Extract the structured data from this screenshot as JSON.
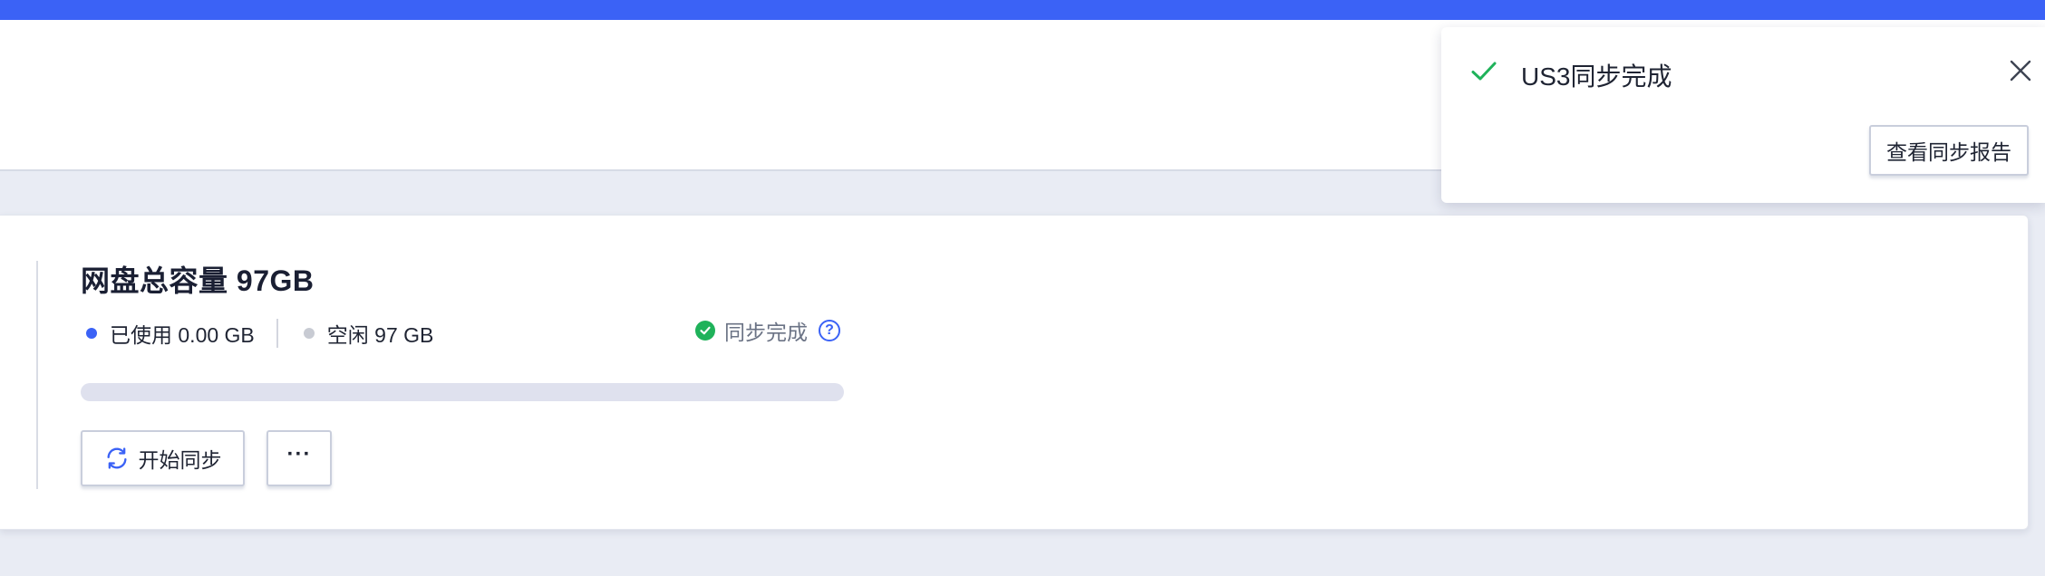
{
  "colors": {
    "accent": "#3b62f6",
    "success": "#1fb25a",
    "progress_track": "#dfe1ee",
    "free_dot": "#c8cbd3"
  },
  "storage_card": {
    "title": "网盘总容量 97GB",
    "used_label": "已使用 0.00 GB",
    "free_label": "空闲 97 GB",
    "sync_status": "同步完成",
    "help_icon_glyph": "?",
    "progress_fraction": 0.0,
    "start_sync_label": "开始同步",
    "more_label": "···"
  },
  "toast": {
    "title": "US3同步完成",
    "view_report_label": "查看同步报告",
    "icon": "check-icon",
    "close_icon": "close-icon"
  }
}
